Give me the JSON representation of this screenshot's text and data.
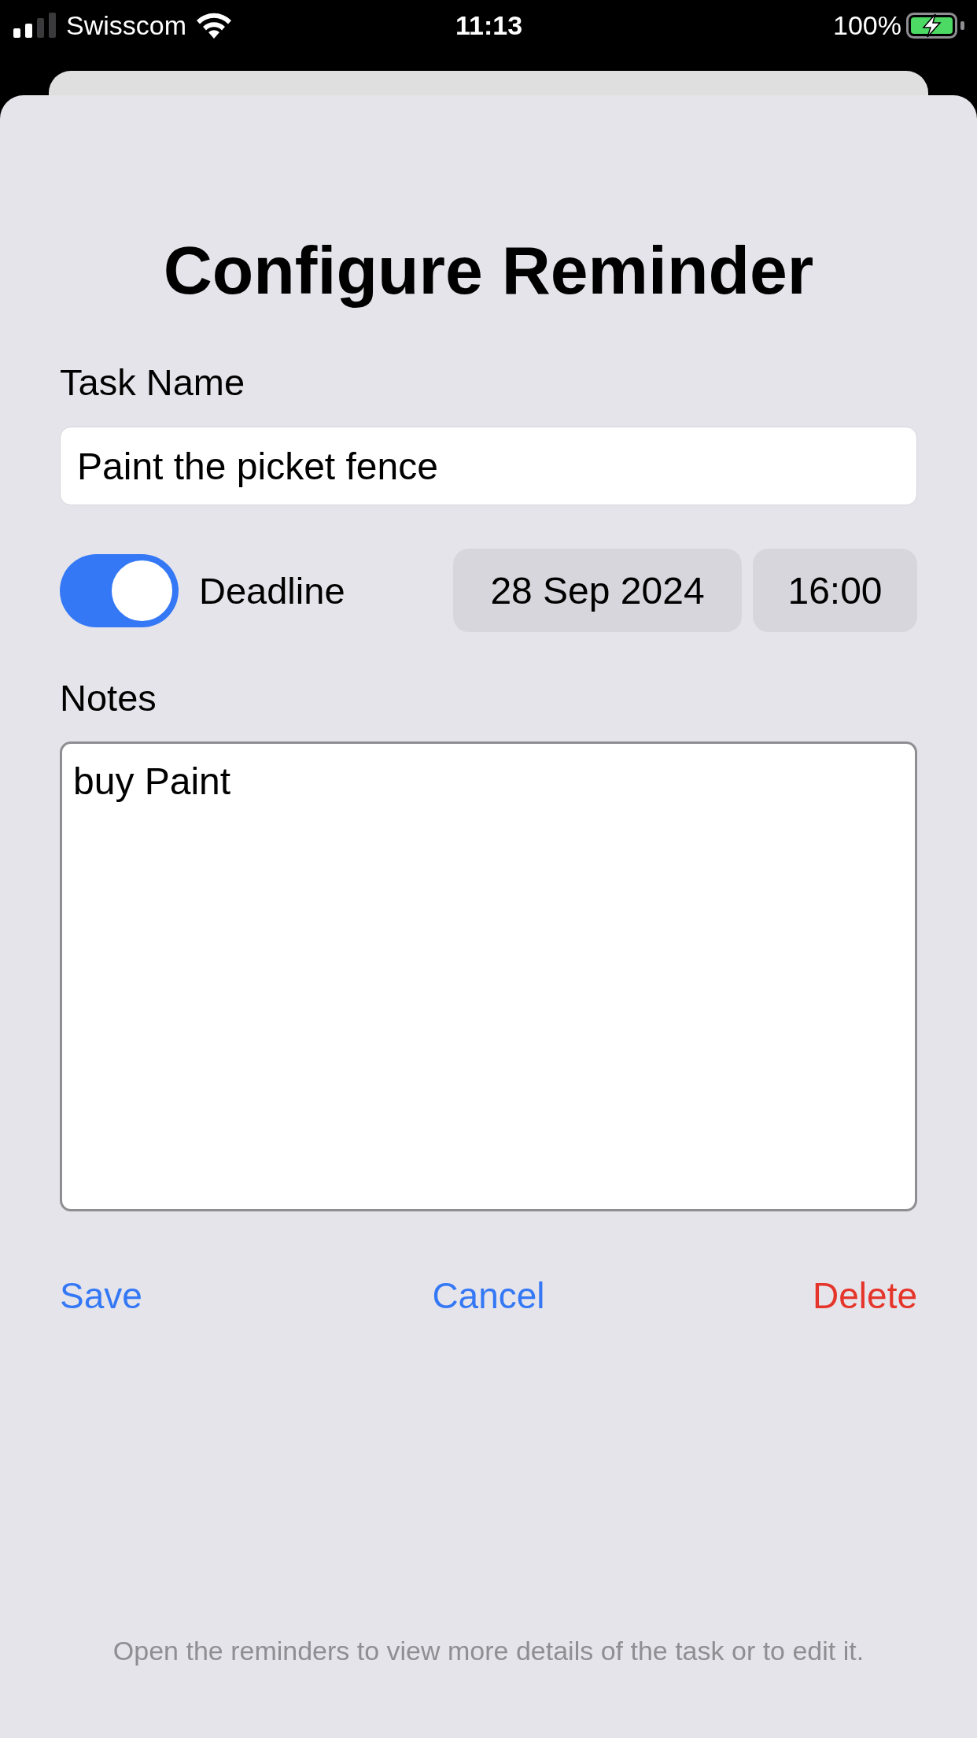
{
  "status_bar": {
    "carrier": "Swisscom",
    "time": "11:13",
    "battery": "100%",
    "charging": true
  },
  "title": "Configure Reminder",
  "task_name": {
    "label": "Task Name",
    "value": "Paint the picket fence"
  },
  "deadline": {
    "label": "Deadline",
    "on": true,
    "date": "28 Sep 2024",
    "time": "16:00"
  },
  "notes": {
    "label": "Notes",
    "value": "buy Paint"
  },
  "actions": [
    {
      "label": "Save",
      "kind": "default"
    },
    {
      "label": "Cancel",
      "kind": "default"
    },
    {
      "label": "Delete",
      "kind": "destructive"
    }
  ],
  "footer": "Open the reminders to view more details of the task or to edit it."
}
